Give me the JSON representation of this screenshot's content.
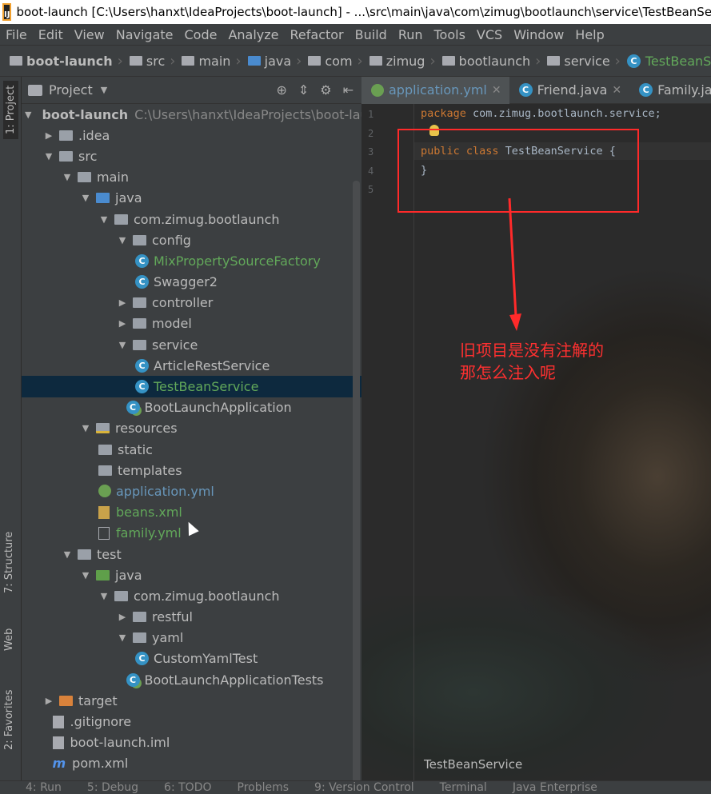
{
  "titlebar": {
    "title": "boot-launch [C:\\Users\\hanxt\\IdeaProjects\\boot-launch] - ...\\src\\main\\java\\com\\zimug\\bootlaunch\\service\\TestBeanServ"
  },
  "menu": [
    "File",
    "Edit",
    "View",
    "Navigate",
    "Code",
    "Analyze",
    "Refactor",
    "Build",
    "Run",
    "Tools",
    "VCS",
    "Window",
    "Help"
  ],
  "breadcrumbs": [
    "boot-launch",
    "src",
    "main",
    "java",
    "com",
    "zimug",
    "bootlaunch",
    "service",
    "TestBeanService"
  ],
  "sidetabs": {
    "project": "1: Project",
    "structure": "7: Structure",
    "web": "Web",
    "favorites": "2: Favorites"
  },
  "project": {
    "title": "Project",
    "root_label": "boot-launch",
    "root_path": "C:\\Users\\hanxt\\IdeaProjects\\boot-laun",
    "tree": [
      {
        "label": ".idea",
        "indent": 1,
        "arrow": "right",
        "icon": "folder"
      },
      {
        "label": "src",
        "indent": 1,
        "arrow": "down",
        "icon": "folder"
      },
      {
        "label": "main",
        "indent": 2,
        "arrow": "down",
        "icon": "folder"
      },
      {
        "label": "java",
        "indent": 3,
        "arrow": "down",
        "icon": "folder-blue"
      },
      {
        "label": "com.zimug.bootlaunch",
        "indent": 4,
        "arrow": "down",
        "icon": "package"
      },
      {
        "label": "config",
        "indent": 5,
        "arrow": "down",
        "icon": "package"
      },
      {
        "label": "MixPropertySourceFactory",
        "indent": 6,
        "arrow": "none",
        "icon": "class",
        "color": "green"
      },
      {
        "label": "Swagger2",
        "indent": 6,
        "arrow": "none",
        "icon": "class"
      },
      {
        "label": "controller",
        "indent": 5,
        "arrow": "right",
        "icon": "package"
      },
      {
        "label": "model",
        "indent": 5,
        "arrow": "right",
        "icon": "package"
      },
      {
        "label": "service",
        "indent": 5,
        "arrow": "down",
        "icon": "package"
      },
      {
        "label": "ArticleRestService",
        "indent": 6,
        "arrow": "none",
        "icon": "class"
      },
      {
        "label": "TestBeanService",
        "indent": 6,
        "arrow": "none",
        "icon": "class",
        "color": "green",
        "selected": true
      },
      {
        "label": "BootLaunchApplication",
        "indent": 5.5,
        "arrow": "none",
        "icon": "spring-class"
      },
      {
        "label": "resources",
        "indent": 3,
        "arrow": "down",
        "icon": "folder-res"
      },
      {
        "label": "static",
        "indent": 4,
        "arrow": "none",
        "icon": "folder"
      },
      {
        "label": "templates",
        "indent": 4,
        "arrow": "none",
        "icon": "folder"
      },
      {
        "label": "application.yml",
        "indent": 4,
        "arrow": "none",
        "icon": "yml",
        "color": "blue"
      },
      {
        "label": "beans.xml",
        "indent": 4,
        "arrow": "none",
        "icon": "xml",
        "color": "green"
      },
      {
        "label": "family.yml",
        "indent": 4,
        "arrow": "none",
        "icon": "table",
        "color": "green"
      },
      {
        "label": "test",
        "indent": 2,
        "arrow": "down",
        "icon": "folder"
      },
      {
        "label": "java",
        "indent": 3,
        "arrow": "down",
        "icon": "folder-green"
      },
      {
        "label": "com.zimug.bootlaunch",
        "indent": 4,
        "arrow": "down",
        "icon": "package"
      },
      {
        "label": "restful",
        "indent": 5,
        "arrow": "right",
        "icon": "package"
      },
      {
        "label": "yaml",
        "indent": 5,
        "arrow": "down",
        "icon": "package"
      },
      {
        "label": "CustomYamlTest",
        "indent": 6,
        "arrow": "none",
        "icon": "class"
      },
      {
        "label": "BootLaunchApplicationTests",
        "indent": 5.5,
        "arrow": "none",
        "icon": "spring-class"
      },
      {
        "label": "target",
        "indent": 1,
        "arrow": "right",
        "icon": "folder-orange"
      },
      {
        "label": ".gitignore",
        "indent": 1.5,
        "arrow": "none",
        "icon": "file"
      },
      {
        "label": "boot-launch.iml",
        "indent": 1.5,
        "arrow": "none",
        "icon": "file"
      },
      {
        "label": "pom.xml",
        "indent": 1.5,
        "arrow": "none",
        "icon": "maven"
      }
    ]
  },
  "editor": {
    "tabs": [
      {
        "label": "application.yml",
        "icon": "yml",
        "active": true
      },
      {
        "label": "Friend.java",
        "icon": "class",
        "active": false
      },
      {
        "label": "Family.java",
        "icon": "class",
        "active": false
      }
    ],
    "lines": [
      {
        "n": "1",
        "kw": "package",
        "rest": " com.zimug.bootlaunch.service;"
      },
      {
        "n": "2",
        "kw": "",
        "rest": ""
      },
      {
        "n": "3",
        "kw": "public class",
        "rest": " TestBeanService {"
      },
      {
        "n": "4",
        "kw": "",
        "rest": "}"
      },
      {
        "n": "5",
        "kw": "",
        "rest": ""
      }
    ],
    "footer": "TestBeanService",
    "annotation_line1": "旧项目是没有注解的",
    "annotation_line2": "那怎么注入呢"
  },
  "statusbar": [
    "4: Run",
    "5: Debug",
    "6: TODO",
    "Problems",
    "9: Version Control",
    "Terminal",
    "Java Enterprise"
  ]
}
